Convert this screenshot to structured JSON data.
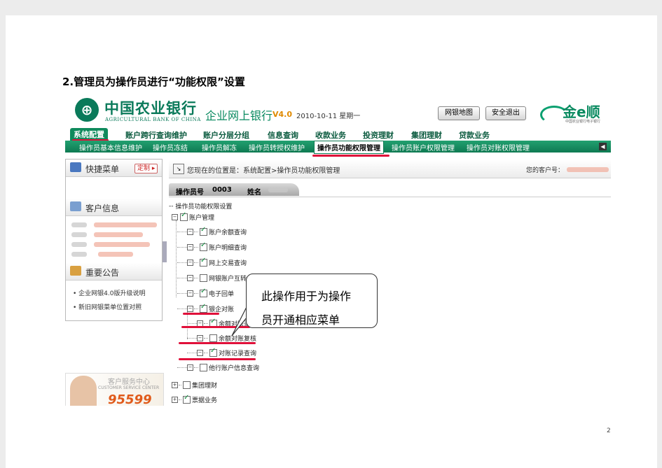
{
  "doc": {
    "heading": "2.管理员为操作员进行“功能权限”设置",
    "page_number": "2"
  },
  "header": {
    "bank_cn": "中国农业银行",
    "bank_en": "AGRICULTURAL BANK OF CHINA",
    "system_title": "企业网上银行",
    "version": "V4.0",
    "date": "2010-10-11 星期一",
    "sitemap_button": "网银地图",
    "logout_button": "安全退出",
    "brand": "金e顺",
    "brand_sub": "中国农业银行电子银行"
  },
  "nav": {
    "items": [
      "系统配置",
      "账户跨行查询维护",
      "账户分层分组",
      "信息查询",
      "收款业务",
      "投资理财",
      "集团理财",
      "贷款业务"
    ]
  },
  "subnav": {
    "items": [
      "操作员基本信息维护",
      "操作员冻结",
      "操作员解冻",
      "操作员转授权维护",
      "操作员功能权限管理",
      "操作员账户权限管理",
      "操作员对账权限管理"
    ]
  },
  "sidebar": {
    "quick_menu": "快捷菜单",
    "customize_button": "定制 ▸",
    "customer_info": "客户信息",
    "announcements": "重要公告",
    "notices": [
      "企业网银4.0版升级说明",
      "新旧网银菜单位置对照"
    ],
    "ad_title": "客户服务中心",
    "ad_en": "CUSTOMER SERVICE CENTER",
    "ad_number": "95599"
  },
  "main": {
    "breadcrumb": "您现在的位置是：系统配置>操作员功能权限管理",
    "customer_no_label": "您的客户号：",
    "operator_no_label": "操作员号",
    "operator_no": "0003",
    "name_label": "姓名"
  },
  "tree": {
    "root": "操作员功能权限设置",
    "account_mgmt": "账户管理",
    "children": [
      {
        "label": "账户余额查询",
        "checked": true
      },
      {
        "label": "账户明细查询",
        "checked": true
      },
      {
        "label": "网上交易查询",
        "checked": true
      },
      {
        "label": "网银账户互转",
        "checked": false
      },
      {
        "label": "电子回单",
        "checked": true
      },
      {
        "label": "银企对账",
        "checked": true
      }
    ],
    "reconcile_children": [
      {
        "label": "余额对账录入",
        "checked": true
      },
      {
        "label": "余额对账复核",
        "checked": false
      },
      {
        "label": "对账记录查询",
        "checked": true
      }
    ],
    "other_bank": {
      "label": "他行账户信息查询",
      "checked": false
    },
    "group_finance": {
      "label": "集团理财",
      "checked": false
    },
    "bill_business": {
      "label": "票据业务",
      "checked": true
    }
  },
  "callout": {
    "line1": "此操作用于为操作",
    "line2": "员开通相应菜单"
  }
}
